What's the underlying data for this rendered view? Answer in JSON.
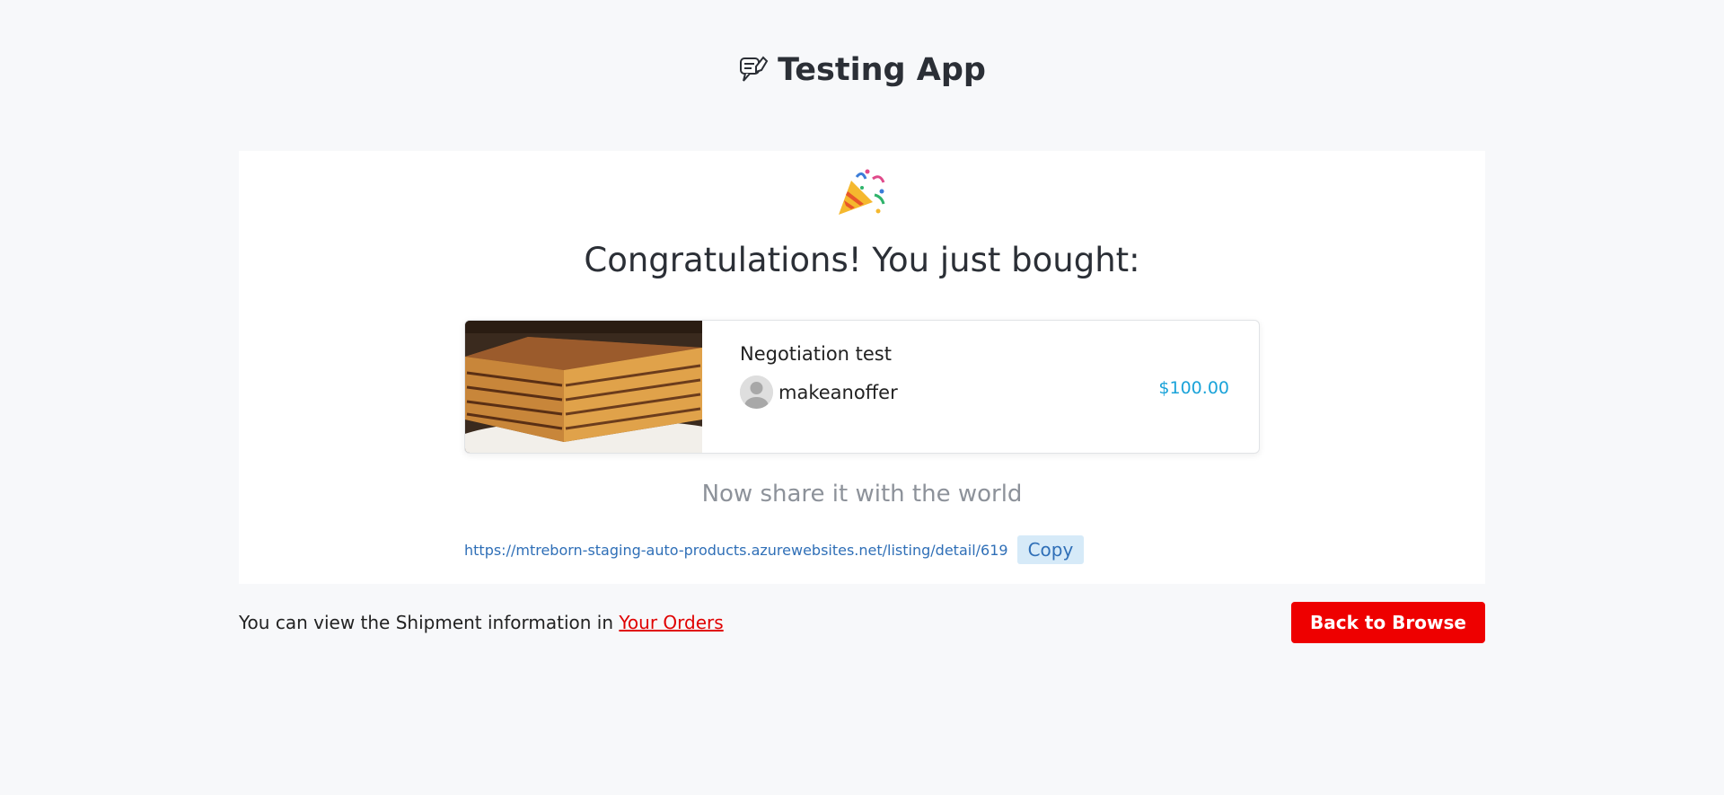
{
  "header": {
    "logo_icon": "chat-hand-icon",
    "title": "Testing App"
  },
  "confirmation": {
    "icon": "party-popper-icon",
    "heading": "Congratulations! You just bought:"
  },
  "product": {
    "image": "layered-chocolate-biscuit-cake",
    "name": "Negotiation test",
    "seller": "makeanoffer",
    "price": "$100.00",
    "price_color": "#1aa3d9"
  },
  "share": {
    "heading": "Now share it with the world",
    "url": "https://mtreborn-staging-auto-products.azurewebsites.net/listing/detail/619",
    "copy_label": "Copy"
  },
  "footer": {
    "note_prefix": "You can view the Shipment information in ",
    "orders_link": "Your Orders",
    "back_button": "Back to Browse",
    "accent": "#ee0000"
  }
}
